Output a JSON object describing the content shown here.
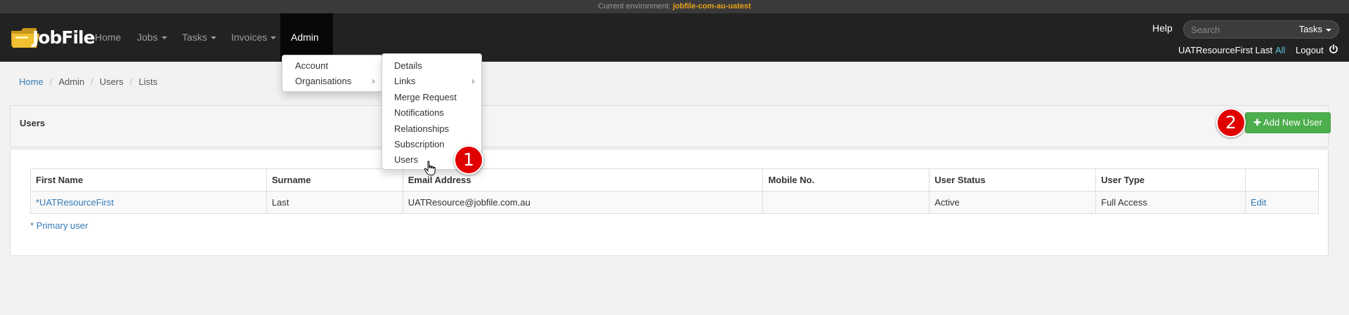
{
  "env": {
    "label": "Current environment:",
    "value": "jobfile-com-au-uatest"
  },
  "brand": {
    "name": "JobFile"
  },
  "nav": {
    "home": "Home",
    "jobs": "Jobs",
    "tasks": "Tasks",
    "invoices": "Invoices",
    "admin": "Admin"
  },
  "header_right": {
    "help": "Help",
    "search_placeholder": "Search",
    "tasks_dropdown": "Tasks",
    "user_name": "UATResourceFirst Last",
    "all": "All",
    "logout": "Logout"
  },
  "admin_menu": {
    "items": [
      "Account",
      "Organisations"
    ]
  },
  "org_submenu": {
    "items": [
      "Details",
      "Links",
      "Merge Request",
      "Notifications",
      "Relationships",
      "Subscription",
      "Users"
    ]
  },
  "breadcrumb": [
    "Home",
    "Admin",
    "Users",
    "Lists"
  ],
  "panel": {
    "title": "Users",
    "add_button": "Add New User"
  },
  "table": {
    "headers": [
      "First Name",
      "Surname",
      "Email Address",
      "Mobile No.",
      "User Status",
      "User Type",
      ""
    ],
    "rows": [
      [
        "*UATResourceFirst",
        "Last",
        "UATResource@jobfile.com.au",
        "",
        "Active",
        "Full Access",
        "Edit"
      ]
    ]
  },
  "primary_note": "* Primary user",
  "annotations": {
    "badge1": "1",
    "badge2": "2"
  },
  "colors": {
    "navbar": "#222222",
    "accent_link": "#337ab7",
    "env_value": "#e8a317",
    "add_button": "#4cae4c",
    "badge": "#e10000"
  }
}
